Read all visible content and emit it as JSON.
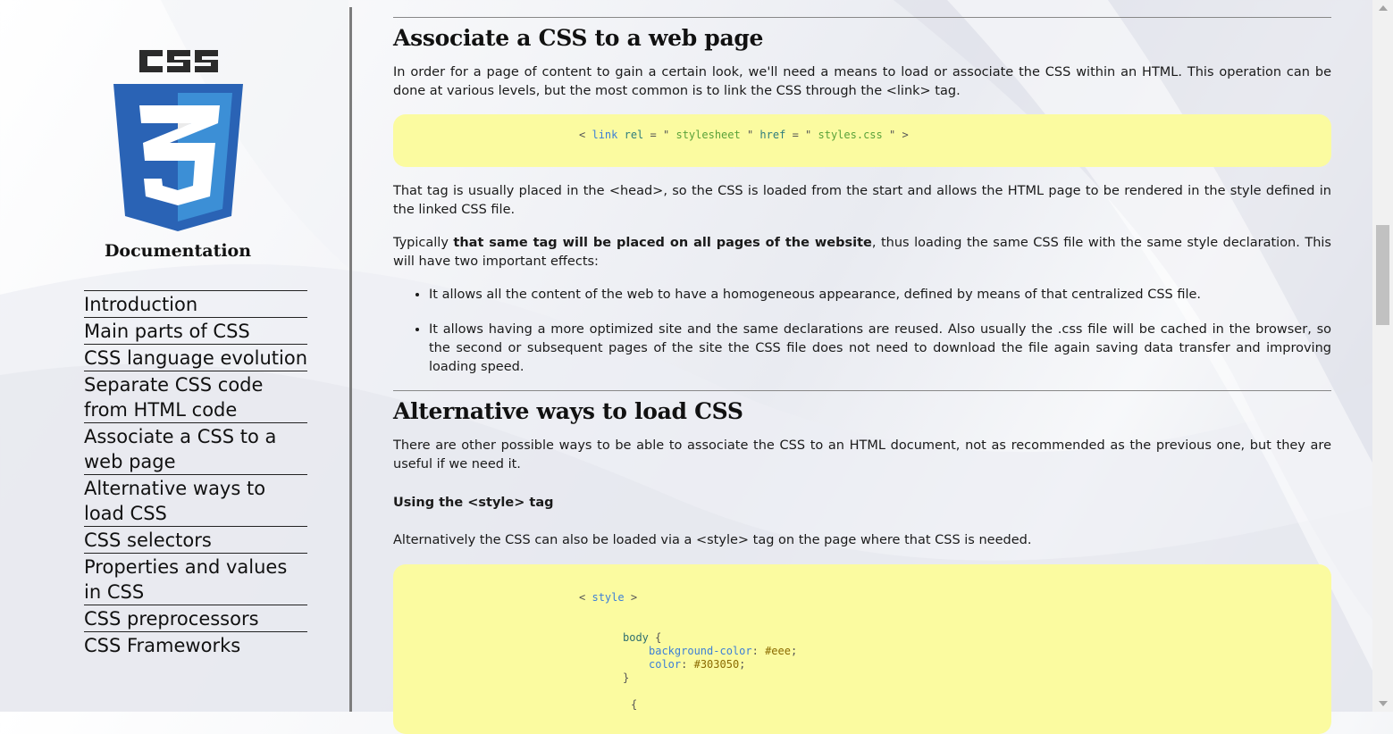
{
  "colors": {
    "code_bg": "#fbfba0",
    "logo_blue": "#2a63b5",
    "logo_light_blue": "#3c8fd6"
  },
  "sidebar": {
    "logo_text": "CSS",
    "title": "Documentation",
    "nav": [
      "Introduction",
      "Main parts of CSS",
      "CSS language evolution",
      "Separate CSS code from HTML code",
      "Associate a CSS to a web page",
      "Alternative ways to load CSS",
      "CSS selectors",
      "Properties and values in CSS",
      "CSS preprocessors",
      "CSS Frameworks"
    ]
  },
  "section1": {
    "heading": "Associate a CSS to a web page",
    "intro": "In order for a page of content to gain a certain look, we'll need a means to load or associate the CSS within an HTML. This operation can be done at various levels, but the most common is to link the CSS through the <link> tag.",
    "code": {
      "open": "<",
      "tag": "link",
      "attr1": "rel",
      "eq": "=",
      "q": "\"",
      "val1": "stylesheet",
      "attr2": "href",
      "val2": "styles.css",
      "close": ">"
    },
    "p2": "That tag is usually placed in the <head>, so the CSS is loaded from the start and allows the HTML page to be rendered in the style defined in the linked CSS file.",
    "p3_pre": "Typically ",
    "p3_bold": "that same tag will be placed on all pages of the website",
    "p3_post": ", thus loading the same CSS file with the same style declaration. This will have two important effects:",
    "bullets": [
      "It allows all the content of the web to have a homogeneous appearance, defined by means of that centralized CSS file.",
      "It allows having a more optimized site and the same declarations are reused. Also usually the .css file will be cached in the browser, so the second or subsequent pages of the site the CSS file does not need to download the file again saving data transfer and improving loading speed."
    ]
  },
  "section2": {
    "heading": "Alternative ways to load CSS",
    "intro": "There are other possible ways to be able to associate the CSS to an HTML document, not as recommended as the previous one, but they are useful if we need it.",
    "subheading": "Using the <style> tag",
    "p2": "Alternatively the CSS can also be loaded via a <style> tag on the page where that CSS is needed.",
    "code": {
      "open": "<",
      "tag": "style",
      "close": ">",
      "selector": "body",
      "brace_open": "{",
      "prop1": "background-color",
      "val1": "#eee",
      "prop2": "color",
      "val2": "#303050",
      "colon": ":",
      "semi": ";",
      "brace_close": "}",
      "next_brace": "{"
    }
  }
}
